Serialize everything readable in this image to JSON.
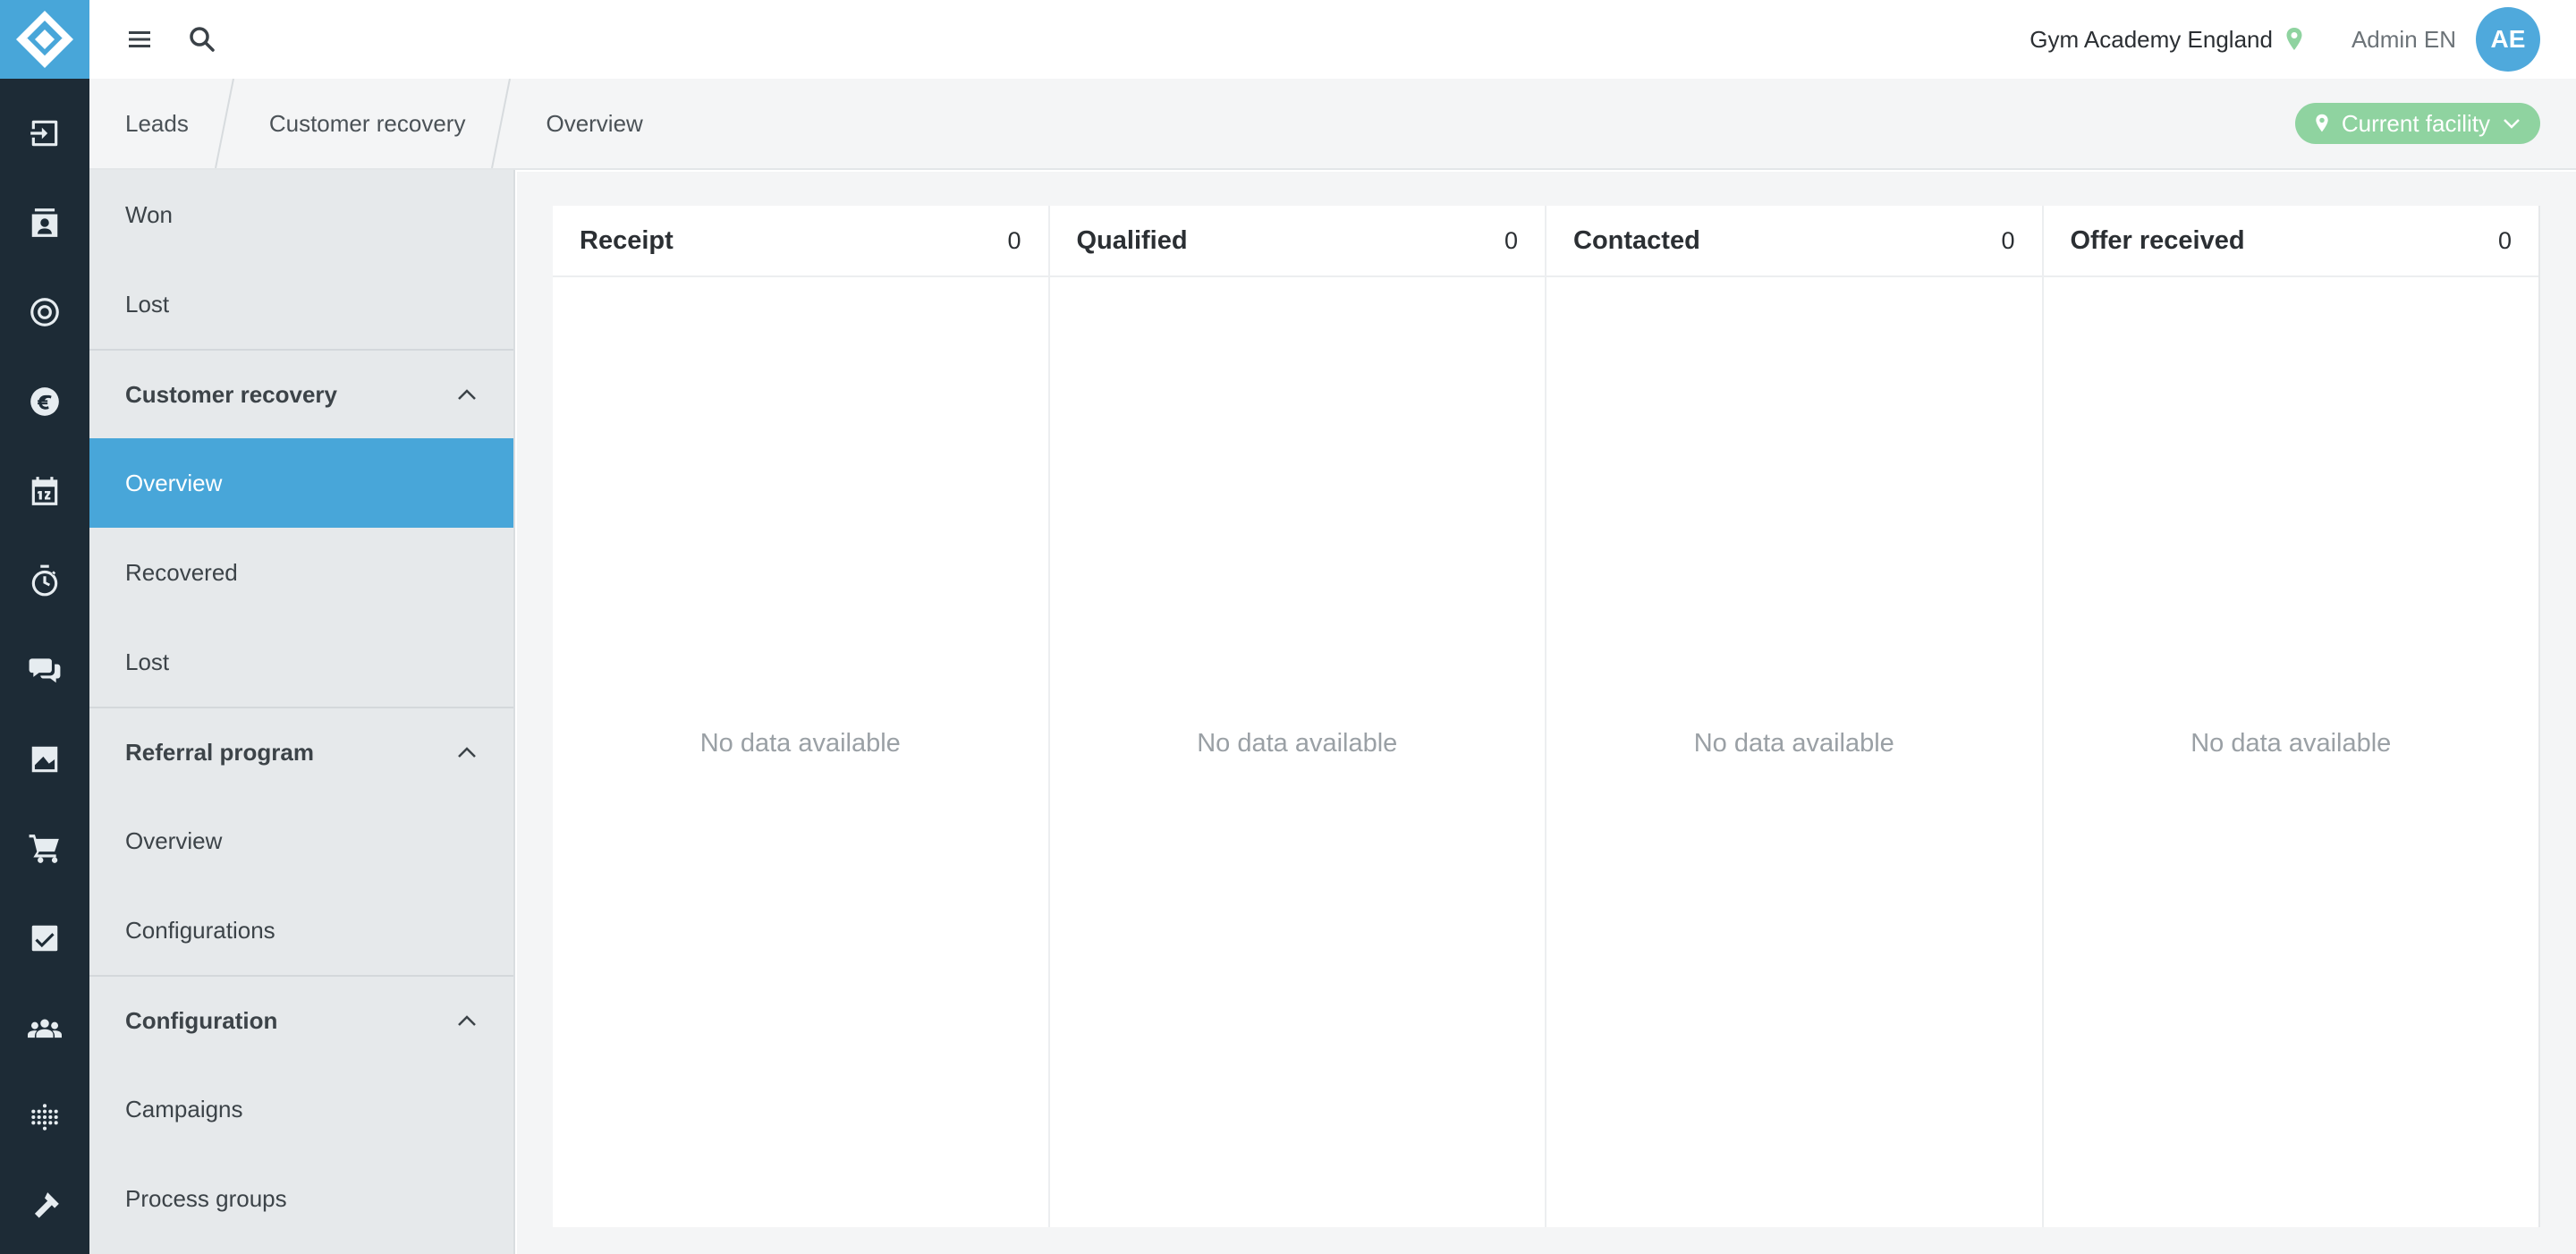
{
  "topbar": {
    "facility": "Gym Academy England",
    "user": "Admin EN",
    "avatar_initials": "AE"
  },
  "breadcrumb": [
    "Leads",
    "Customer recovery",
    "Overview"
  ],
  "facility_filter": {
    "label": "Current facility"
  },
  "rail_icons": [
    "sign-in-icon",
    "contacts-icon",
    "target-icon",
    "euro-icon",
    "calendar-icon",
    "stopwatch-icon",
    "chat-icon",
    "chart-icon",
    "cart-icon",
    "checkbox-icon",
    "users-icon",
    "dots-grid-icon",
    "hammer-icon"
  ],
  "subnav": {
    "top_items": [
      "Won",
      "Lost"
    ],
    "groups": [
      {
        "title": "Customer recovery",
        "items": [
          "Overview",
          "Recovered",
          "Lost"
        ],
        "active": "Overview"
      },
      {
        "title": "Referral program",
        "items": [
          "Overview",
          "Configurations"
        ]
      },
      {
        "title": "Configuration",
        "items": [
          "Campaigns",
          "Process groups"
        ]
      }
    ]
  },
  "board": {
    "columns": [
      {
        "title": "Receipt",
        "count": "0",
        "empty": "No data available"
      },
      {
        "title": "Qualified",
        "count": "0",
        "empty": "No data available"
      },
      {
        "title": "Contacted",
        "count": "0",
        "empty": "No data available"
      },
      {
        "title": "Offer received",
        "count": "0",
        "empty": "No data available"
      }
    ]
  },
  "colors": {
    "rail": "#1d2b36",
    "accent": "#48a6d9",
    "facility_button": "#8fd3a0",
    "pin": "#8fd3a0"
  }
}
